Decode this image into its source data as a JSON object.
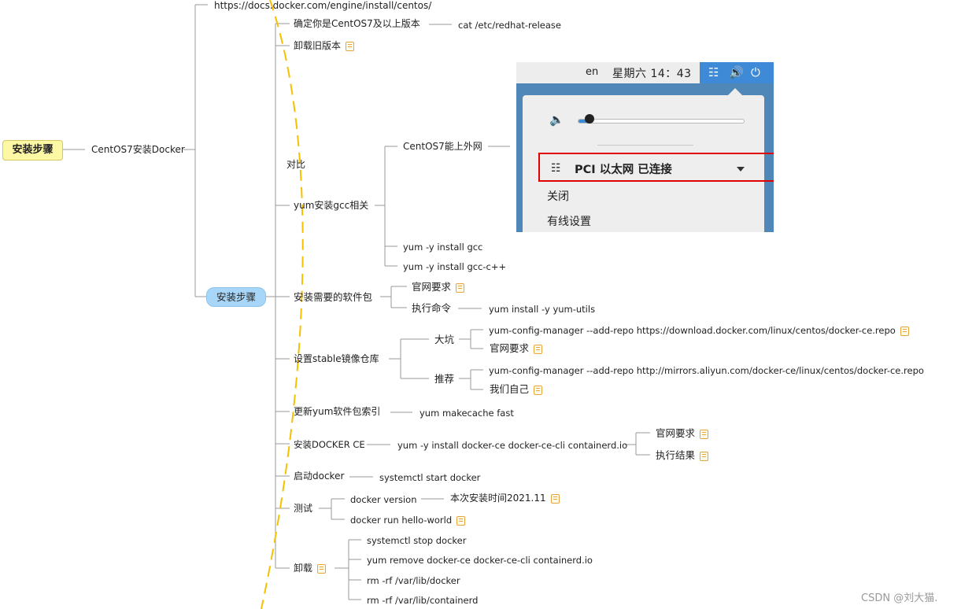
{
  "root": {
    "label": "安装步骤"
  },
  "centos_node": "CentOS7安装Docker",
  "url": "https://docs.docker.com/engine/install/centos/",
  "check_version": {
    "label": "确定你是CentOS7及以上版本",
    "cmd": "cat /etc/redhat-release"
  },
  "uninstall_old": "卸载旧版本",
  "compare": "对比",
  "net_ok": "CentOS7能上外网",
  "gcc": {
    "label": "yum安装gcc相关",
    "cmd1": "yum -y install gcc",
    "cmd2": "yum -y install gcc-c++"
  },
  "steps_pill": "安装步骤",
  "pkgs": {
    "label": "安装需要的软件包",
    "official": "官网要求",
    "exec": "执行命令",
    "cmd": "yum install -y yum-utils"
  },
  "stable": {
    "label": "设置stable镜像仓库",
    "pit": "大坑",
    "pit_cmd": "yum-config-manager --add-repo https://download.docker.com/linux/centos/docker-ce.repo",
    "pit_official": "官网要求",
    "rec": "推荐",
    "rec_cmd": "yum-config-manager --add-repo http://mirrors.aliyun.com/docker-ce/linux/centos/docker-ce.repo",
    "rec_self": "我们自己"
  },
  "makecache": {
    "label": "更新yum软件包索引",
    "cmd": "yum makecache fast"
  },
  "install_ce": {
    "label": "安装DOCKER CE",
    "cmd": "yum -y install docker-ce docker-ce-cli containerd.io",
    "official": "官网要求",
    "result": "执行结果"
  },
  "start": {
    "label": "启动docker",
    "cmd": "systemctl start docker"
  },
  "test": {
    "label": "测试",
    "cmd1": "docker version",
    "note": "本次安装时间2021.11",
    "cmd2": "docker run hello-world"
  },
  "uninstall": {
    "label": "卸载",
    "cmd1": "systemctl stop docker",
    "cmd2": "yum remove docker-ce docker-ce-cli containerd.io",
    "cmd3": "rm -rf /var/lib/docker",
    "cmd4": "rm -rf /var/lib/containerd"
  },
  "screenshot": {
    "lang": "en",
    "clock": "星期六 14：43",
    "network": "PCI 以太网  已连接",
    "menu_close": "关闭",
    "menu_wired": "有线设置",
    "volume_level": 0.07
  },
  "watermark": "CSDN @刘大猫.",
  "colors": {
    "root_bg": "#fdf8a4",
    "pill_bg": "#a8d6f8",
    "dash": "#f5c000",
    "highlight": "#e00000",
    "system_blue": "#3f8ad6"
  }
}
